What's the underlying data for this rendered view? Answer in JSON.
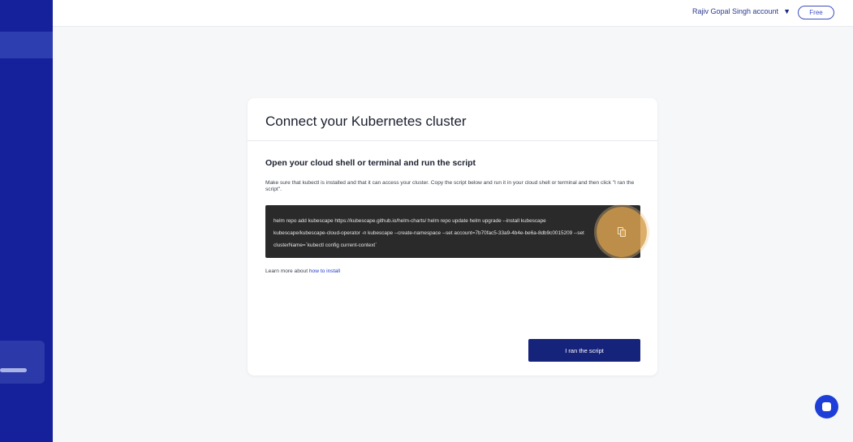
{
  "header": {
    "account_label": "Rajiv Gopal Singh account",
    "account_chevron": "⌄",
    "plan_badge": "Free",
    "help_icon": "?"
  },
  "card": {
    "title": "Connect your Kubernetes cluster",
    "section_title": "Open your cloud shell or terminal and run the script",
    "instruction": "Make sure that kubectl is installed and that it can access your cluster. Copy the script below and run it in your cloud shell or terminal and then click \"I ran the script\".",
    "script": "helm repo add kubescape https://kubescape.github.io/helm-charts/ helm repo update helm upgrade --install kubescape kubescape/kubescape-cloud-operator -n kubescape --create-namespace --set account=7b70fac5-33a9-4b4e-be6a-8db9c0015209 --set clusterName=`kubectl config current-context`",
    "learn_more_prefix": "Learn more about ",
    "learn_more_link": "how to install",
    "run_button": "I ran the script"
  },
  "icons": {
    "copy": "copy-icon",
    "chat": "chat-icon",
    "help": "help-icon",
    "avatar": "avatar"
  },
  "colors": {
    "sidebar": "#14219a",
    "primary_button": "#16237a",
    "script_bg": "#2a2a2a",
    "highlight": "#d6a050",
    "chat": "#1d3fd8"
  }
}
